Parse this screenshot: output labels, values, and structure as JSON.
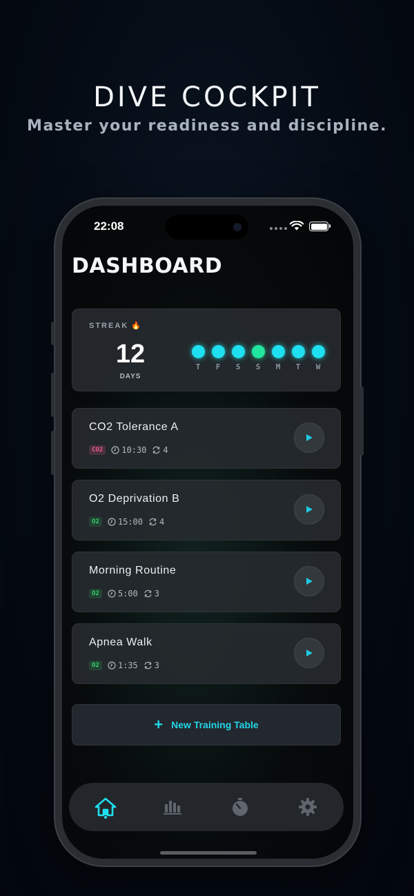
{
  "hero": {
    "title": "DIVE COCKPIT",
    "subtitle": "Master your readiness and discipline."
  },
  "status_bar": {
    "time": "22:08"
  },
  "dashboard": {
    "title": "DASHBOARD"
  },
  "streak": {
    "label": "STREAK",
    "count": "12",
    "unit": "DAYS",
    "days": [
      {
        "letter": "T",
        "status": "done"
      },
      {
        "letter": "F",
        "status": "done"
      },
      {
        "letter": "S",
        "status": "done"
      },
      {
        "letter": "S",
        "status": "done-alt"
      },
      {
        "letter": "M",
        "status": "done"
      },
      {
        "letter": "T",
        "status": "done"
      },
      {
        "letter": "W",
        "status": "done"
      }
    ]
  },
  "sessions": [
    {
      "name": "CO2 Tolerance A",
      "tag": "CO2",
      "duration": "10:30",
      "rounds": "4"
    },
    {
      "name": "O2 Deprivation B",
      "tag": "O2",
      "duration": "15:00",
      "rounds": "4"
    },
    {
      "name": "Morning Routine",
      "tag": "O2",
      "duration": "5:00",
      "rounds": "3"
    },
    {
      "name": "Apnea Walk",
      "tag": "O2",
      "duration": "1:35",
      "rounds": "3"
    }
  ],
  "new_table": {
    "label": "New Training Table",
    "icon": "plus-icon"
  },
  "tabbar": {
    "items": [
      {
        "icon": "home-icon",
        "active": true
      },
      {
        "icon": "stats-icon",
        "active": false
      },
      {
        "icon": "stopwatch-icon",
        "active": false
      },
      {
        "icon": "gear-icon",
        "active": false
      }
    ]
  },
  "colors": {
    "accent": "#1fe0f0",
    "streak_alt": "#22e6a0",
    "co2_tag": "#f45c8c",
    "o2_tag": "#2fd36b"
  }
}
